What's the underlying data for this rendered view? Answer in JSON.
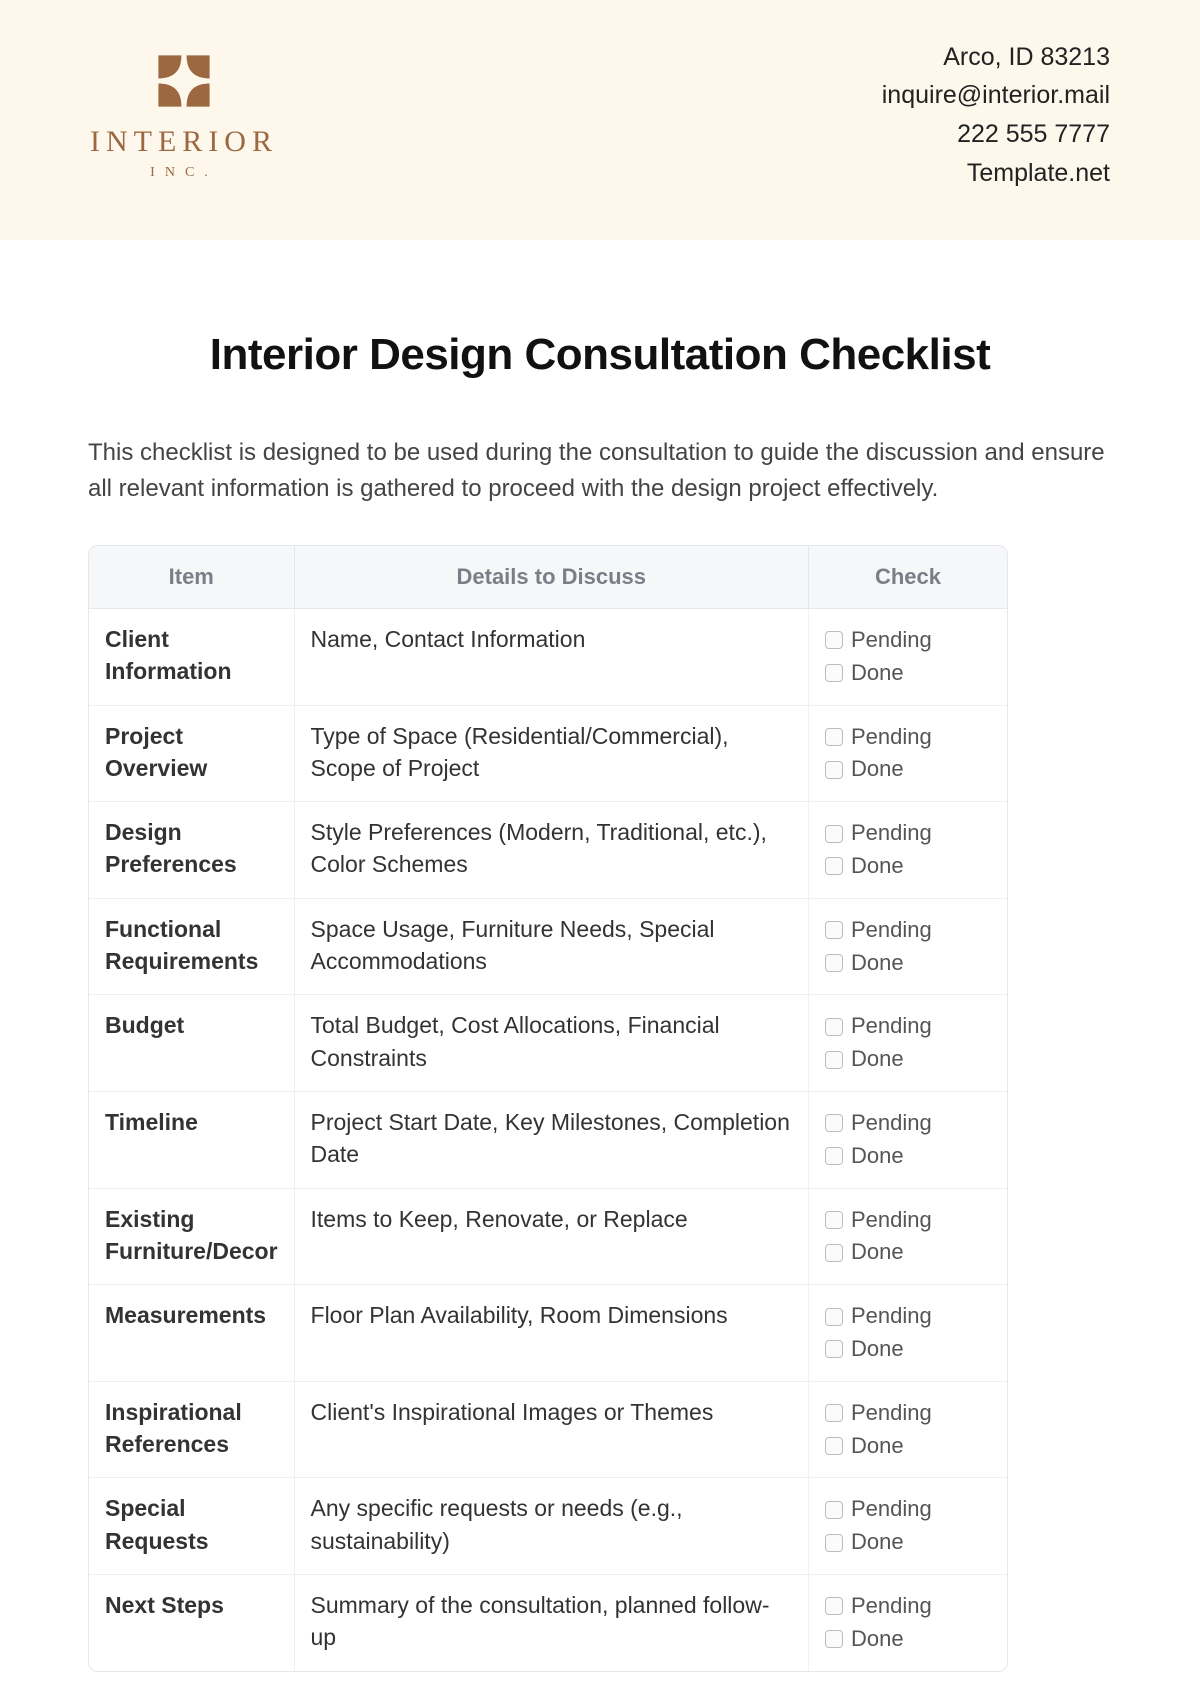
{
  "brand": {
    "name": "INTERIOR",
    "sub": "INC."
  },
  "contact": {
    "line1": "Arco, ID 83213",
    "line2": "inquire@interior.mail",
    "line3": "222 555 7777",
    "line4": "Template.net"
  },
  "page": {
    "title": "Interior Design Consultation Checklist",
    "intro": "This checklist is designed to be used during the consultation to guide the discussion and ensure all relevant information is gathered to proceed with the design project effectively."
  },
  "table": {
    "headers": {
      "item": "Item",
      "details": "Details to Discuss",
      "check": "Check"
    },
    "checkOptions": {
      "pending": "Pending",
      "done": "Done"
    },
    "rows": [
      {
        "item": "Client Information",
        "details": "Name, Contact Information"
      },
      {
        "item": "Project Overview",
        "details": "Type of Space (Residential/Commercial), Scope of Project"
      },
      {
        "item": "Design Preferences",
        "details": "Style Preferences (Modern, Traditional, etc.), Color Schemes"
      },
      {
        "item": "Functional Requirements",
        "details": "Space Usage, Furniture Needs, Special Accommodations"
      },
      {
        "item": "Budget",
        "details": "Total Budget, Cost Allocations, Financial Constraints"
      },
      {
        "item": "Timeline",
        "details": "Project Start Date, Key Milestones, Completion Date"
      },
      {
        "item": "Existing Furniture/Decor",
        "details": "Items to Keep, Renovate, or Replace"
      },
      {
        "item": "Measurements",
        "details": "Floor Plan Availability, Room Dimensions"
      },
      {
        "item": "Inspirational References",
        "details": "Client's Inspirational Images or Themes"
      },
      {
        "item": "Special Requests",
        "details": "Any specific requests or needs (e.g., sustainability)"
      },
      {
        "item": "Next Steps",
        "details": "Summary of the consultation, planned follow-up"
      }
    ]
  }
}
